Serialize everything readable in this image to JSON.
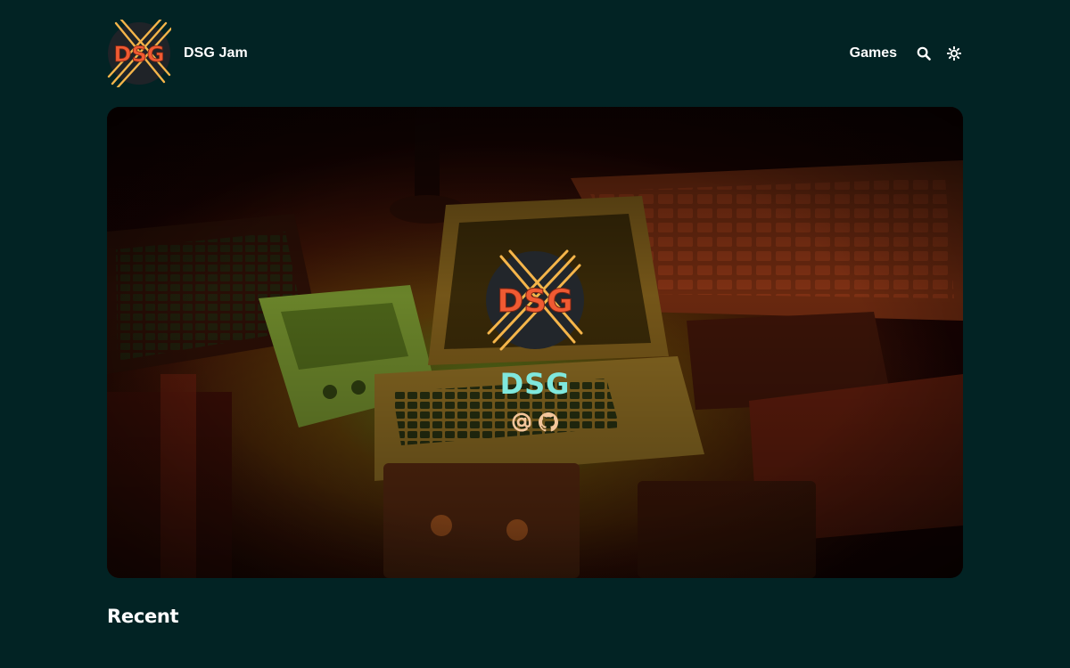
{
  "header": {
    "logo_text": "DSG",
    "site_name": "DSG Jam",
    "nav_games": "Games",
    "search_icon": "search-icon",
    "theme_icon": "sun-icon"
  },
  "hero": {
    "logo_text": "DSG",
    "title": "DSG",
    "links": [
      {
        "icon": "at-sign-icon"
      },
      {
        "icon": "github-icon"
      }
    ]
  },
  "sections": {
    "recent_title": "Recent"
  },
  "colors": {
    "background": "#022324",
    "accent_teal": "#7fe8dd",
    "logo_orange": "#f05a32",
    "logo_stripes": "#f5b54a",
    "logo_circle": "#22262b",
    "icon_peach": "#f3c59b"
  }
}
